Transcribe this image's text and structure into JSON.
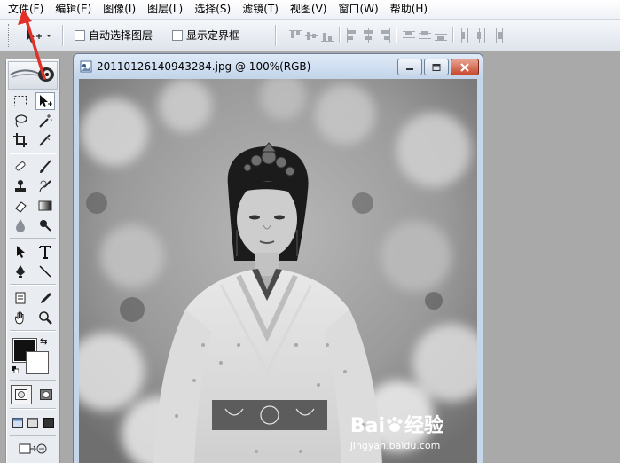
{
  "menu": [
    "文件(F)",
    "编辑(E)",
    "图像(I)",
    "图层(L)",
    "选择(S)",
    "滤镜(T)",
    "视图(V)",
    "窗口(W)",
    "帮助(H)"
  ],
  "options": {
    "auto_select_layer": "自动选择图层",
    "show_bounding_box": "显示定界框"
  },
  "document": {
    "title": "20110126140943284.jpg @ 100%(RGB)"
  },
  "watermark": {
    "logo_text": "Bai",
    "logo_suffix": "经验",
    "url": "jingyan.baidu.com"
  },
  "colors": {
    "foreground": "#111111",
    "background": "#ffffff",
    "annotation_arrow": "#e0302a"
  },
  "icons": [
    "move-icon",
    "marquee-icon",
    "lasso-icon",
    "magic-wand-icon",
    "crop-icon",
    "slice-icon",
    "healing-brush-icon",
    "brush-icon",
    "stamp-icon",
    "history-brush-icon",
    "eraser-icon",
    "gradient-icon",
    "blur-icon",
    "dodge-icon",
    "path-select-icon",
    "type-icon",
    "pen-icon",
    "line-icon",
    "notes-icon",
    "eyedropper-icon",
    "hand-icon",
    "zoom-icon"
  ]
}
